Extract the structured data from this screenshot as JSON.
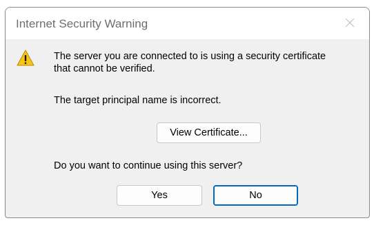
{
  "dialog": {
    "title": "Internet Security Warning",
    "close_icon": "close-icon",
    "warning_icon": "warning-triangle-icon",
    "message_lines": [
      "The server you are connected to is using a security certificate",
      "that cannot be verified."
    ],
    "detail": "The target principal name is incorrect.",
    "view_certificate_label": "View Certificate...",
    "question": "Do you want to continue using this server?",
    "yes_label": "Yes",
    "no_label": "No"
  },
  "colors": {
    "dialog_background": "#f0f0f0",
    "titlebar_background": "#ffffff",
    "title_text": "#6d6d6d",
    "default_button_border": "#0067c0",
    "warning_yellow": "#f7c514"
  }
}
